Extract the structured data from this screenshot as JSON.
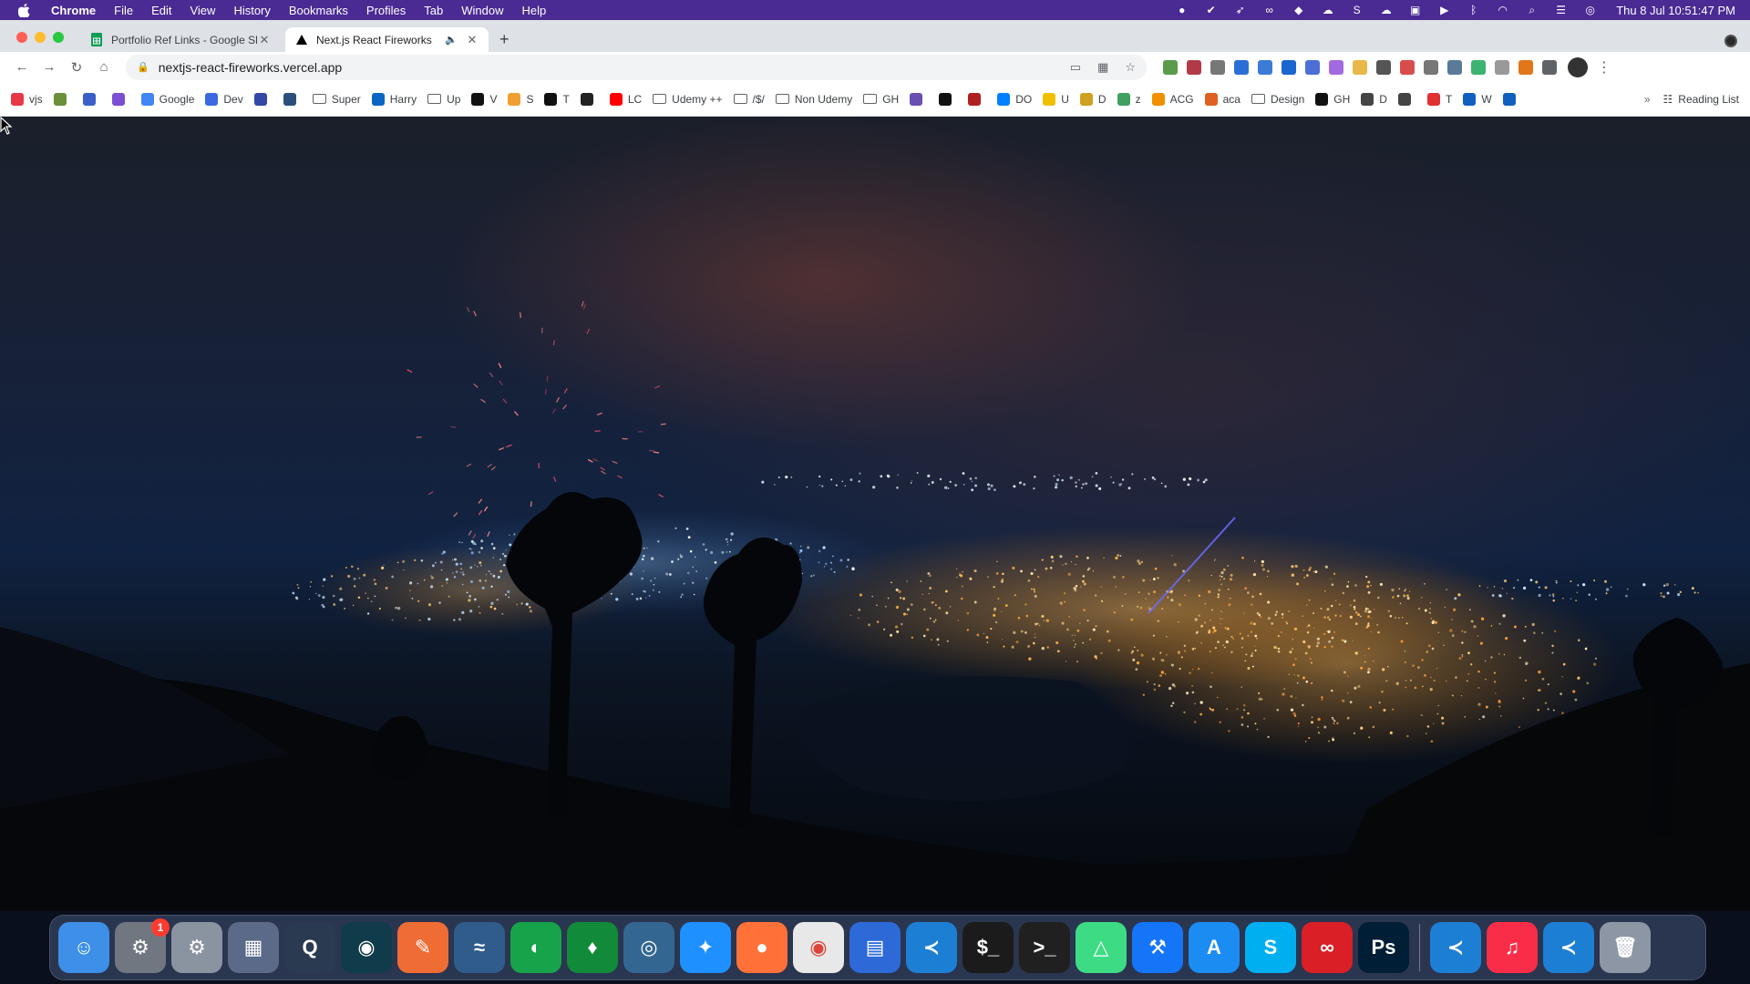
{
  "menubar": {
    "app_name": "Chrome",
    "menus": [
      "File",
      "Edit",
      "View",
      "History",
      "Bookmarks",
      "Profiles",
      "Tab",
      "Window",
      "Help"
    ],
    "clock": "Thu 8 Jul  10:51:47 PM"
  },
  "tabs": [
    {
      "title": "Portfolio Ref Links - Google Sh",
      "favicon": "sheets-icon",
      "active": false
    },
    {
      "title": "Next.js React Fireworks",
      "favicon": "vercel-icon",
      "active": true
    }
  ],
  "toolbar": {
    "url": "nextjs-react-fireworks.vercel.app"
  },
  "bookmarks": {
    "items": [
      {
        "label": "vjs",
        "icon": "notion",
        "color": "#e63946"
      },
      {
        "label": "",
        "icon": "app",
        "color": "#6b8f3a"
      },
      {
        "label": "",
        "icon": "app",
        "color": "#3a5fc8"
      },
      {
        "label": "",
        "icon": "app",
        "color": "#7a4fd1"
      },
      {
        "label": "Google",
        "icon": "google",
        "color": "#4285f4"
      },
      {
        "label": "Dev",
        "icon": "dev",
        "color": "#3b6ae0"
      },
      {
        "label": "",
        "icon": "app",
        "color": "#3348a6"
      },
      {
        "label": "",
        "icon": "app",
        "color": "#2a4f7a"
      },
      {
        "label": "Super",
        "icon": "folder"
      },
      {
        "label": "Harry",
        "icon": "linkedin",
        "color": "#0a66c2"
      },
      {
        "label": "Up",
        "icon": "folder"
      },
      {
        "label": "V",
        "icon": "app",
        "color": "#111111"
      },
      {
        "label": "S",
        "icon": "app",
        "color": "#f0a030"
      },
      {
        "label": "T",
        "icon": "app",
        "color": "#111111"
      },
      {
        "label": "",
        "icon": "app",
        "color": "#222222"
      },
      {
        "label": "LC",
        "icon": "youtube",
        "color": "#ff0000"
      },
      {
        "label": "Udemy ++",
        "icon": "folder"
      },
      {
        "label": "/$/",
        "icon": "folder"
      },
      {
        "label": "Non Udemy",
        "icon": "folder"
      },
      {
        "label": "GH",
        "icon": "folder"
      },
      {
        "label": "",
        "icon": "app",
        "color": "#6a4fb0"
      },
      {
        "label": "",
        "icon": "app",
        "color": "#111111"
      },
      {
        "label": "",
        "icon": "app",
        "color": "#b02020"
      },
      {
        "label": "DO",
        "icon": "app",
        "color": "#0080ff"
      },
      {
        "label": "U",
        "icon": "app",
        "color": "#f0c000"
      },
      {
        "label": "D",
        "icon": "app",
        "color": "#d0a020"
      },
      {
        "label": "z",
        "icon": "app",
        "color": "#40a060"
      },
      {
        "label": "ACG",
        "icon": "app",
        "color": "#f09000"
      },
      {
        "label": "aca",
        "icon": "app",
        "color": "#e06020"
      },
      {
        "label": "Design",
        "icon": "folder"
      },
      {
        "label": "GH",
        "icon": "github",
        "color": "#111111"
      },
      {
        "label": "D",
        "icon": "app",
        "color": "#444444"
      },
      {
        "label": "",
        "icon": "app",
        "color": "#444444"
      },
      {
        "label": "T",
        "icon": "app",
        "color": "#e03030"
      },
      {
        "label": "W",
        "icon": "app",
        "color": "#1060c0"
      },
      {
        "label": "",
        "icon": "app",
        "color": "#1060c0"
      }
    ],
    "more": "»",
    "reading_list": "Reading List"
  },
  "dock": {
    "items": [
      {
        "name": "finder",
        "color": "#3d8fe8",
        "glyph": "☺"
      },
      {
        "name": "system-preferences",
        "color": "#707780",
        "glyph": "⚙",
        "badge": "1"
      },
      {
        "name": "settings-2",
        "color": "#8a93a0",
        "glyph": "⚙"
      },
      {
        "name": "launchpad",
        "color": "#5a6a88",
        "glyph": "▦"
      },
      {
        "name": "quicktime",
        "color": "#2a3a50",
        "glyph": "Q"
      },
      {
        "name": "gitkraken",
        "color": "#0f3b4a",
        "glyph": "◉"
      },
      {
        "name": "postman",
        "color": "#ef6c34",
        "glyph": "✎"
      },
      {
        "name": "mysql-workbench",
        "color": "#2f5c8a",
        "glyph": "≈"
      },
      {
        "name": "mongodb-compass",
        "color": "#16a34a",
        "glyph": "◐"
      },
      {
        "name": "mongodb",
        "color": "#118a3a",
        "glyph": "♦"
      },
      {
        "name": "postgres",
        "color": "#336791",
        "glyph": "◎"
      },
      {
        "name": "safari",
        "color": "#1e90ff",
        "glyph": "✦"
      },
      {
        "name": "firefox",
        "color": "#ff7139",
        "glyph": "●"
      },
      {
        "name": "chrome",
        "color": "#e8e8e8",
        "glyph": "◉"
      },
      {
        "name": "keynote",
        "color": "#2d6ad8",
        "glyph": "▤"
      },
      {
        "name": "vscode",
        "color": "#1d7fd4",
        "glyph": "≺"
      },
      {
        "name": "terminal",
        "color": "#1b1b1b",
        "glyph": "$_"
      },
      {
        "name": "iterm",
        "color": "#202020",
        "glyph": ">_"
      },
      {
        "name": "android-studio",
        "color": "#3ddc84",
        "glyph": "△"
      },
      {
        "name": "xcode",
        "color": "#1575f9",
        "glyph": "⚒"
      },
      {
        "name": "app-store",
        "color": "#1b8cf2",
        "glyph": "A"
      },
      {
        "name": "skype",
        "color": "#00aff0",
        "glyph": "S"
      },
      {
        "name": "creative-cloud",
        "color": "#da1f26",
        "glyph": "∞"
      },
      {
        "name": "photoshop",
        "color": "#001e36",
        "glyph": "Ps"
      },
      {
        "sep": true
      },
      {
        "name": "vscode-insiders",
        "color": "#1d7fd4",
        "glyph": "≺"
      },
      {
        "name": "music",
        "color": "#fa2d48",
        "glyph": "♫"
      },
      {
        "name": "vscode-2",
        "color": "#1d7fd4",
        "glyph": "≺"
      },
      {
        "name": "trash",
        "color": "#8d96a4",
        "glyph": "🗑"
      }
    ]
  }
}
